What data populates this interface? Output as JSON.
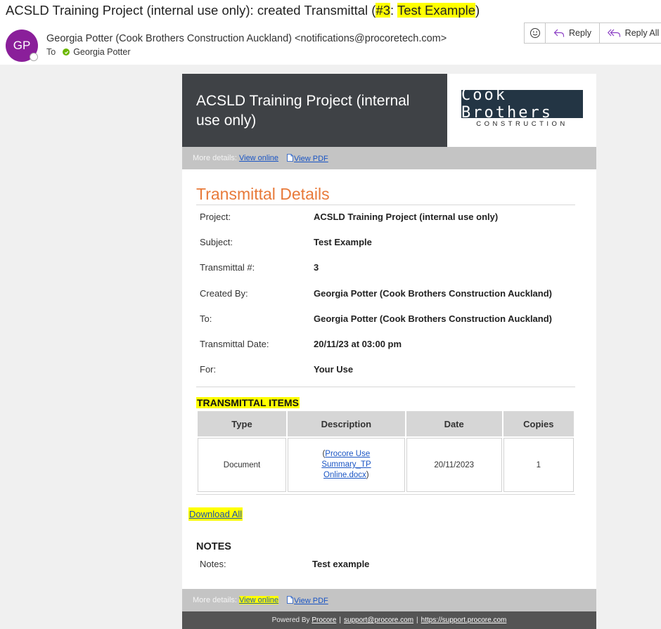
{
  "email": {
    "subject_prefix": "ACSLD Training Project (internal use only): created Transmittal (",
    "subject_num": "#3",
    "subject_colon": ": ",
    "subject_title": "Test Example",
    "subject_suffix": ")",
    "avatar_initials": "GP",
    "sender": "Georgia Potter (Cook Brothers Construction Auckland) <notifications@procoretech.com>",
    "to_label": "To",
    "to_name": "Georgia Potter"
  },
  "actions": {
    "emoji_icon": "smiley-icon",
    "reply_label": "Reply",
    "reply_all_label": "Reply All"
  },
  "banner": {
    "title": "ACSLD Training Project (internal use only)",
    "logo_main": "Cook Brothers",
    "logo_sub": "CONSTRUCTION"
  },
  "details_bar": {
    "label": "More details:",
    "view_online": "View online",
    "view_pdf": "View PDF"
  },
  "transmittal": {
    "section_title": "Transmittal Details",
    "fields": [
      {
        "label": "Project:",
        "value": "ACSLD Training Project (internal use only)"
      },
      {
        "label": "Subject:",
        "value": "Test Example"
      },
      {
        "label": "Transmittal #:",
        "value": "3"
      },
      {
        "label": "Created By:",
        "value": "Georgia Potter (Cook Brothers Construction Auckland)"
      },
      {
        "label": "To:",
        "value": "Georgia Potter (Cook Brothers Construction Auckland)"
      },
      {
        "label": "Transmittal Date:",
        "value": "20/11/23 at 03:00 pm"
      },
      {
        "label": "For:",
        "value": "Your Use"
      }
    ]
  },
  "items": {
    "title": "TRANSMITTAL ITEMS",
    "headers": [
      "Type",
      "Description",
      "Date",
      "Copies"
    ],
    "rows": [
      {
        "type": "Document",
        "description_open": "(",
        "description_link": "Procore Use Summary_TP Online.docx",
        "description_close": ")",
        "date": "20/11/2023",
        "copies": "1"
      }
    ],
    "download_all": "Download All"
  },
  "notes": {
    "title": "NOTES",
    "label": "Notes:",
    "value": "Test example"
  },
  "footer": {
    "powered_by": "Powered By",
    "procore": "Procore",
    "support_email": "support@procore.com",
    "support_url": "https://support.procore.com"
  },
  "colors": {
    "highlight": "#ffff00",
    "section_title": "#e87a3a",
    "avatar": "#8a1f9a",
    "banner": "#3f4246",
    "logo": "#233544"
  }
}
